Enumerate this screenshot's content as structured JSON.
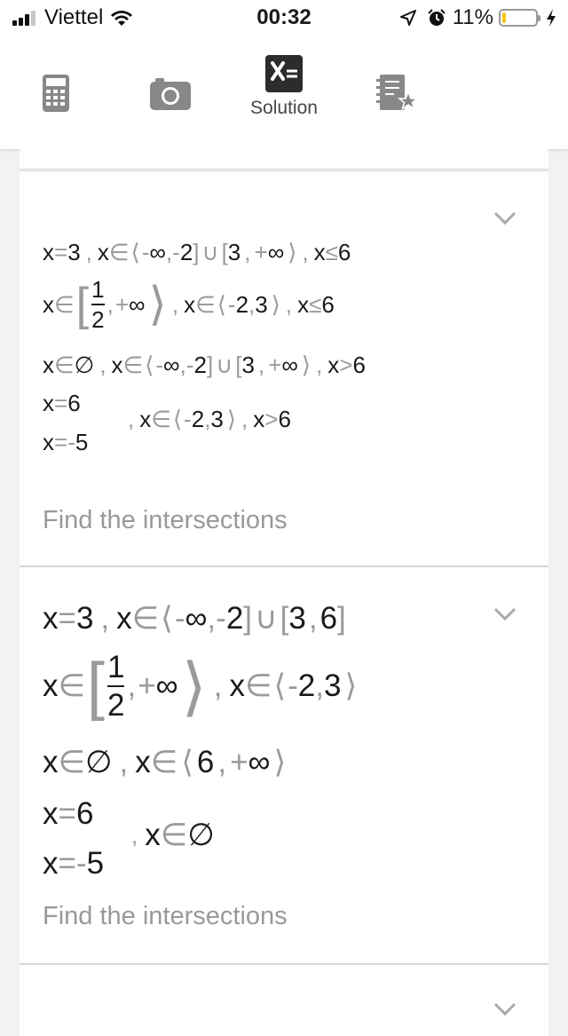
{
  "status": {
    "carrier": "Viettel",
    "time": "00:32",
    "battery_pct": "11%",
    "battery_level": 0.11,
    "battery_color": "#f5c518"
  },
  "toolbar": {
    "items": [
      {
        "icon": "calculator-icon",
        "label": ""
      },
      {
        "icon": "camera-icon",
        "label": ""
      },
      {
        "icon": "solution-icon",
        "label": "Solution",
        "active": true
      },
      {
        "icon": "favorites-notebook-icon",
        "label": ""
      }
    ]
  },
  "steps": [
    {
      "lines": {
        "l1": [
          "x",
          "=",
          "3",
          ",",
          "x",
          "∈",
          "⟨",
          "-",
          "∞",
          ",",
          "-",
          "2",
          "]",
          "∪",
          "[",
          "3",
          ",",
          "+",
          "∞",
          "⟩",
          ",",
          "x",
          "≤",
          "6"
        ],
        "l2": [
          "x",
          "∈",
          "1",
          "2",
          ",",
          "+",
          "∞",
          ",",
          "x",
          "∈",
          "⟨",
          "-",
          "2",
          ",",
          "3",
          "⟩",
          ",",
          "x",
          "≤",
          "6"
        ],
        "l3": [
          "x",
          "∈",
          "∅",
          ",",
          "x",
          "∈",
          "⟨",
          "-",
          "∞",
          ",",
          "-",
          "2",
          "]",
          "∪",
          "[",
          "3",
          ",",
          "+",
          "∞",
          "⟩",
          ",",
          "x",
          ">",
          "6"
        ],
        "l4": [
          "x",
          "=",
          "6"
        ],
        "l5": [
          "x",
          "=",
          "-",
          "5",
          ",",
          "x",
          "∈",
          "⟨",
          "-",
          "2",
          ",",
          "3",
          "⟩",
          ",",
          "x",
          ">",
          "6"
        ]
      },
      "action": "Find the intersections"
    },
    {
      "lines": {
        "l1": [
          "x",
          "=",
          "3",
          ",",
          "x",
          "∈",
          "⟨",
          "-",
          "∞",
          ",",
          "-",
          "2",
          "]",
          "∪",
          "[",
          "3",
          ",",
          "6",
          "]"
        ],
        "l2": [
          "x",
          "∈",
          "1",
          "2",
          ",",
          "+",
          "∞",
          ",",
          "x",
          "∈",
          "⟨",
          "-",
          "2",
          ",",
          "3",
          "⟩"
        ],
        "l3": [
          "x",
          "∈",
          "∅",
          ",",
          "x",
          "∈",
          "⟨",
          "6",
          ",",
          "+",
          "∞",
          "⟩"
        ],
        "l4": [
          "x",
          "=",
          "6"
        ],
        "l5": [
          "x",
          "=",
          "-",
          "5",
          ",",
          "x",
          "∈",
          "∅"
        ]
      },
      "action": "Find the intersections"
    }
  ]
}
